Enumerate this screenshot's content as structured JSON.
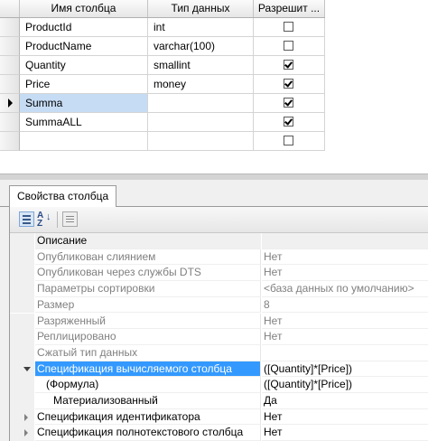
{
  "grid": {
    "columns": [
      "Имя столбца",
      "Тип данных",
      "Разрешит ..."
    ],
    "rows": [
      {
        "name": "ProductId",
        "type": "int",
        "allow_nulls": false
      },
      {
        "name": "ProductName",
        "type": "varchar(100)",
        "allow_nulls": false
      },
      {
        "name": "Quantity",
        "type": "smallint",
        "allow_nulls": true
      },
      {
        "name": "Price",
        "type": "money",
        "allow_nulls": true
      },
      {
        "name": "Summa",
        "type": "",
        "allow_nulls": true,
        "selected": true
      },
      {
        "name": "SummaALL",
        "type": "",
        "allow_nulls": true
      },
      {
        "name": "",
        "type": "",
        "allow_nulls": false
      }
    ]
  },
  "properties": {
    "tab_label": "Свойства столбца",
    "rows": [
      {
        "name": "Описание",
        "value": "",
        "kind": "category"
      },
      {
        "name": "Опубликован слиянием",
        "value": "Нет",
        "kind": "dim"
      },
      {
        "name": "Опубликован через службы DTS",
        "value": "Нет",
        "kind": "dim"
      },
      {
        "name": "Параметры сортировки",
        "value": "<база данных по умолчанию>",
        "kind": "dim"
      },
      {
        "name": "Размер",
        "value": "8",
        "kind": "dim"
      },
      {
        "name": "Разряженный",
        "value": "Нет",
        "kind": "dim"
      },
      {
        "name": "Реплицировано",
        "value": "Нет",
        "kind": "dim"
      },
      {
        "name": "Сжатый тип данных",
        "value": "",
        "kind": "dim"
      },
      {
        "name": "Спецификация вычисляемого столбца",
        "value": "([Quantity]*[Price])",
        "kind": "selected",
        "expander": "expanded"
      },
      {
        "name": "(Формула)",
        "value": "([Quantity]*[Price])",
        "kind": "indent"
      },
      {
        "name": "Материализованный",
        "value": "Да",
        "kind": "indent2"
      },
      {
        "name": "Спецификация идентификатора",
        "value": "Нет",
        "kind": "normal",
        "expander": "collapsed"
      },
      {
        "name": "Спецификация полнотекстового столбца",
        "value": "Нет",
        "kind": "normal",
        "expander": "collapsed"
      }
    ]
  },
  "toolbar": {
    "categorized_icon": "categorized-icon",
    "alphabetical_icon": "alphabetical-sort-icon",
    "alphabetical_glyph": "A Z",
    "alphabetical_arrow": "↓",
    "property_pages_icon": "property-pages-icon"
  }
}
